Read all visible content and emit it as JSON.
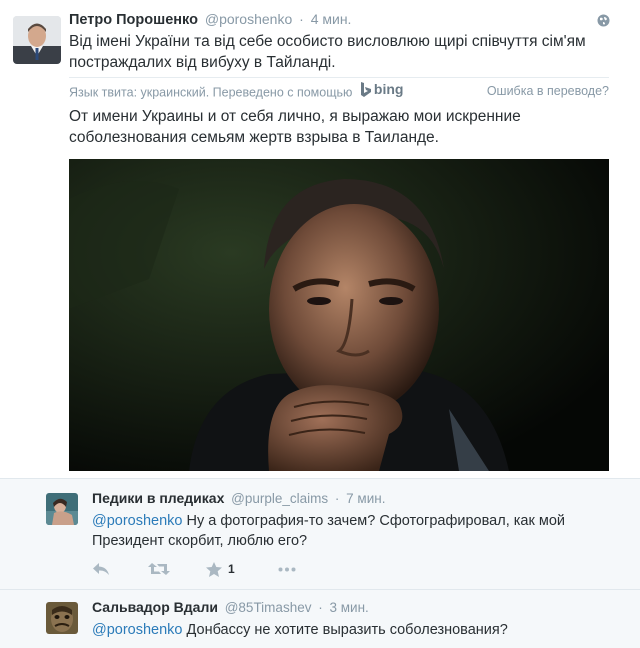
{
  "tweet": {
    "fullname": "Петро Порошенко",
    "username": "@poroshenko",
    "dot": "·",
    "time": "4 мин.",
    "text": "Від імені України та від себе особисто висловлюю щирі співчуття сім'ям постраждалих від вибуху в Тайланді.",
    "translation_bar": {
      "language_note": "Язык твита: украинский. Переведено с помощью",
      "provider": "bing",
      "error_link": "Ошибка в переводе?"
    },
    "translated_text": "От имени Украины и от себя лично, я выражаю мои искренние соболезнования семьям жертв взрыва в Таиланде."
  },
  "replies": [
    {
      "fullname": "Педики в пледиках",
      "username": "@purple_claims",
      "dot": "·",
      "time": "7 мин.",
      "mention": "@poroshenko",
      "text": " Ну а фотография-то зачем? Сфотографировал, как мой Президент скорбит, люблю его?",
      "favorite_count": "1"
    },
    {
      "fullname": "Сальвадор Вдали",
      "username": "@85Timashev",
      "dot": "·",
      "time": "3 мин.",
      "mention": "@poroshenko",
      "text": " Донбассу не хотите выразить соболезнования?"
    }
  ],
  "icons": {
    "globe": "globe-icon",
    "reply": "reply-icon",
    "retweet": "retweet-icon",
    "favorite": "star-icon",
    "more": "more-icon",
    "bing": "bing-logo-icon"
  },
  "colors": {
    "link": "#2b7bb9",
    "meta": "#8899a6",
    "text": "#292f33",
    "reply_bg": "#f5f8fa"
  }
}
